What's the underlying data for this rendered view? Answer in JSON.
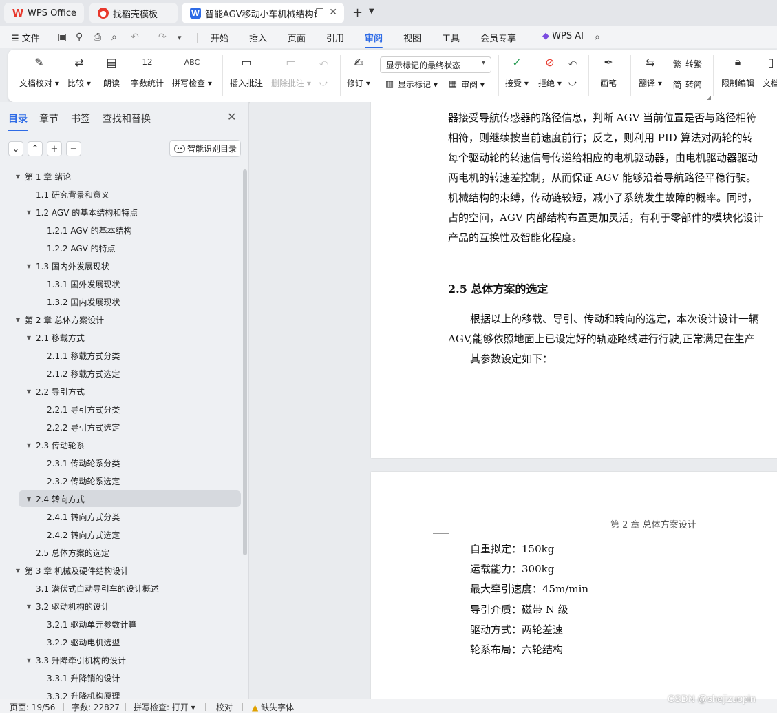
{
  "tabs": [
    {
      "label": "WPS Office",
      "icon": "wps-logo-icon"
    },
    {
      "label": "找稻壳模板",
      "icon": "docer-icon"
    },
    {
      "label": "智能AGV移动小车机械结构设计",
      "icon": "wps-writer-icon"
    }
  ],
  "menubar": {
    "file": "文件",
    "items": [
      "开始",
      "插入",
      "页面",
      "引用",
      "审阅",
      "视图",
      "工具",
      "会员专享"
    ],
    "active": "审阅",
    "wps_ai": "WPS AI"
  },
  "toolbar": {
    "doc_proofread": "文档校对",
    "compare": "比较",
    "read_aloud": "朗读",
    "word_count": "字数统计",
    "spell_check": "拼写检查",
    "spell_icon_text": "ABC",
    "count_icon_text": "12",
    "insert_comment": "插入批注",
    "delete_comment": "删除批注",
    "revise": "修订",
    "markup_mode": "显示标记的最终状态",
    "show_markup": "显示标记",
    "review": "审阅",
    "accept": "接受",
    "reject": "拒绝",
    "pen": "画笔",
    "translate": "翻译",
    "to_traditional": "转繁",
    "to_simplified": "转简",
    "restrict_edit": "限制编辑",
    "doc_more": "文档"
  },
  "nav": {
    "tabs": [
      "目录",
      "章节",
      "书签",
      "查找和替换"
    ],
    "active_tab": "目录",
    "ai_toc": "智能识别目录",
    "toc": [
      {
        "text": "第 1 章   绪论",
        "level": 1,
        "expanded": true
      },
      {
        "text": "1.1  研究背景和意义",
        "level": 2
      },
      {
        "text": "1.2 AGV 的基本结构和特点",
        "level": 2,
        "expanded": true
      },
      {
        "text": "1.2.1 AGV 的基本结构",
        "level": 3
      },
      {
        "text": "1.2.2 AGV 的特点",
        "level": 3
      },
      {
        "text": "1.3 国内外发展现状",
        "level": 2,
        "expanded": true
      },
      {
        "text": "1.3.1 国外发展现状",
        "level": 3
      },
      {
        "text": "1.3.2  国内发展现状",
        "level": 3
      },
      {
        "text": "第 2 章  总体方案设计",
        "level": 1,
        "expanded": true
      },
      {
        "text": "2.1  移载方式",
        "level": 2,
        "expanded": true
      },
      {
        "text": "2.1.1  移载方式分类",
        "level": 3
      },
      {
        "text": "2.1.2  移载方式选定",
        "level": 3
      },
      {
        "text": "2.2  导引方式",
        "level": 2,
        "expanded": true
      },
      {
        "text": "2.2.1  导引方式分类",
        "level": 3
      },
      {
        "text": "2.2.2  导引方式选定",
        "level": 3
      },
      {
        "text": "2.3  传动轮系",
        "level": 2,
        "expanded": true
      },
      {
        "text": "2.3.1  传动轮系分类",
        "level": 3
      },
      {
        "text": "2.3.2  传动轮系选定",
        "level": 3
      },
      {
        "text": "2.4  转向方式",
        "level": 2,
        "expanded": true,
        "selected": true
      },
      {
        "text": "2.4.1  转向方式分类",
        "level": 3
      },
      {
        "text": "2.4.2  转向方式选定",
        "level": 3
      },
      {
        "text": "2.5  总体方案的选定",
        "level": 2
      },
      {
        "text": "第 3 章  机械及硬件结构设计",
        "level": 1,
        "expanded": true
      },
      {
        "text": "3.1  潜伏式自动导引车的设计概述",
        "level": 2
      },
      {
        "text": "3.2  驱动机构的设计",
        "level": 2,
        "expanded": true
      },
      {
        "text": "3.2.1  驱动单元参数计算",
        "level": 3
      },
      {
        "text": "3.2.2  驱动电机选型",
        "level": 3
      },
      {
        "text": "3.3  升降牵引机构的设计",
        "level": 2,
        "expanded": true
      },
      {
        "text": "3.3.1 升降销的设计",
        "level": 3
      },
      {
        "text": "3.3.2 升降机构原理",
        "level": 3
      }
    ]
  },
  "document": {
    "page1_lines": [
      "器接受导航传感器的路径信息，判断  AGV  当前位置是否与路径相符",
      "相符，则继续按当前速度前行；反之，则利用  PID  算法对两轮的转",
      "每个驱动轮的转速信号传递给相应的电机驱动器，由电机驱动器驱动",
      "两电机的转速差控制，从而保证  AGV  能够沿着导航路径平稳行驶。",
      "机械结构的束缚，传动链较短，减小了系统发生故障的概率。同时，",
      "占的空间，AGV 内部结构布置更加灵活，有利于零部件的模块化设计",
      "产品的互换性及智能化程度。"
    ],
    "heading": "2.5  总体方案的选定",
    "para_lines": [
      "根据以上的移载、导引、传动和转向的选定，本次设计设计一辆",
      "AGV,能够依照地面上已设定好的轨迹路线进行行驶,正常满足在生产",
      "其参数设定如下："
    ],
    "page2_header": "第 2 章  总体方案设计",
    "params": [
      "自重拟定：150kg",
      "运载能力：300kg",
      "最大牵引速度：45m/min",
      "导引介质：磁带 N 级",
      "驱动方式：两轮差速",
      "轮系布局：六轮结构"
    ]
  },
  "status": {
    "page": "页面: 19/56",
    "words": "字数: 22827",
    "spell": "拼写检查: 打开",
    "proof": "校对",
    "missing_font": "缺失字体"
  },
  "watermark": "CSDN @shejizuopin",
  "colors": {
    "accent": "#2e6be6",
    "wps_red": "#e8382c"
  }
}
